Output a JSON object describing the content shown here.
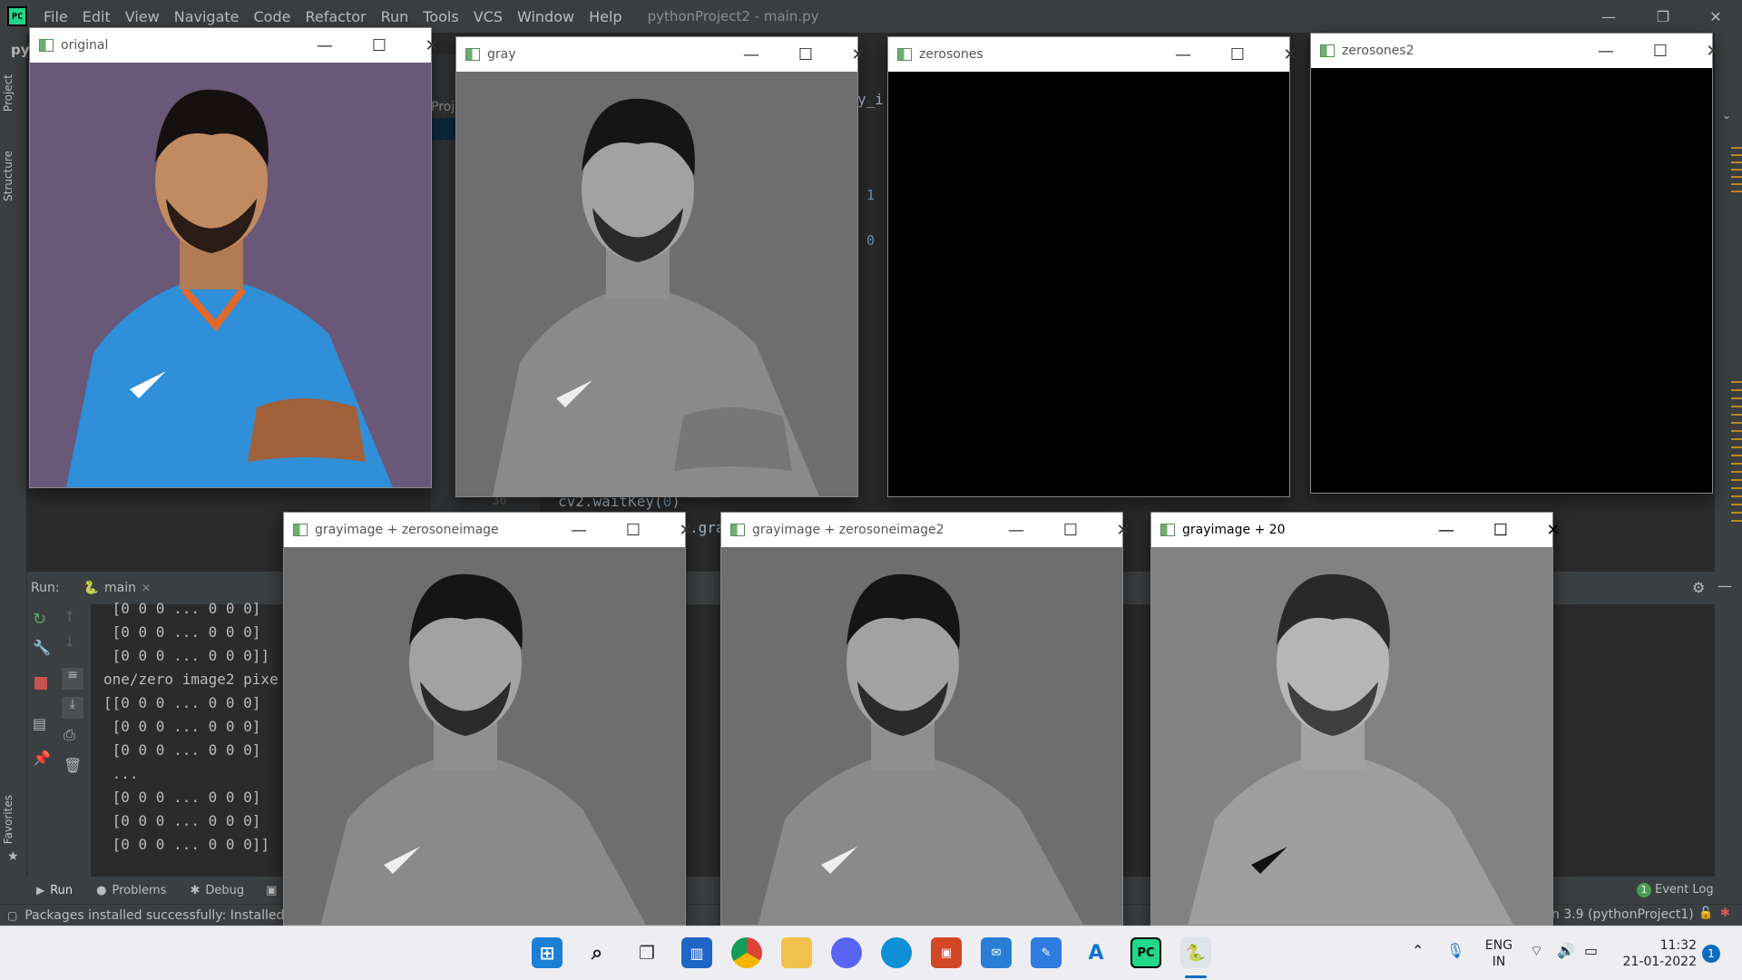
{
  "ide": {
    "logo": "PC",
    "menu": [
      "File",
      "Edit",
      "View",
      "Navigate",
      "Code",
      "Refactor",
      "Run",
      "Tools",
      "VCS",
      "Window",
      "Help"
    ],
    "title": "pythonProject2 - main.py",
    "side_tabs": {
      "project": "Project",
      "structure": "Structure",
      "favorites": "Favorites"
    },
    "project_prefix": "py",
    "project_fragment": "Proje",
    "editor_fragment": "y_i",
    "line_numbers_right": [
      "1",
      "0"
    ],
    "gutter_line": "36",
    "code_line_prefix": "cv2.waitKey(",
    "code_line_arg": "0",
    "code_line_suffix": ")",
    "code_fragment2": ".gra",
    "run_label": "Run:",
    "run_config": "main",
    "console": [
      " [0 0 0 ... 0 0 0]",
      " [0 0 0 ... 0 0 0]",
      " [0 0 0 ... 0 0 0]]",
      "one/zero image2 pixe",
      "[[0 0 0 ... 0 0 0]",
      " [0 0 0 ... 0 0 0]",
      " [0 0 0 ... 0 0 0]",
      " ...",
      " [0 0 0 ... 0 0 0]",
      " [0 0 0 ... 0 0 0]",
      " [0 0 0 ... 0 0 0]]"
    ],
    "bottom_tabs": {
      "run": "Run",
      "problems": "Problems",
      "debug": "Debug"
    },
    "event_log": "Event Log",
    "event_count": "1",
    "status_left": "Packages installed successfully: Installed pa",
    "status_right": "n 3.9 (pythonProject1)"
  },
  "windows": [
    {
      "title": "original",
      "content": "color-photo"
    },
    {
      "title": "gray",
      "content": "gray-photo"
    },
    {
      "title": "zerosones",
      "content": "black"
    },
    {
      "title": "zerosones2",
      "content": "black"
    },
    {
      "title": "grayimage + zerosoneimage",
      "content": "gray-photo"
    },
    {
      "title": "grayimage + zerosoneimage2",
      "content": "gray-photo"
    },
    {
      "title": "grayimage + 20",
      "content": "gray-photo",
      "active": true
    }
  ],
  "taskbar": {
    "apps": [
      "start-icon",
      "search-icon",
      "task-view-icon",
      "widgets-icon",
      "chrome-icon",
      "file-explorer-icon",
      "discord-icon",
      "edge-icon",
      "office-icon",
      "mail-icon",
      "notepad-icon",
      "azure-icon",
      "pycharm-icon",
      "python-icon"
    ],
    "lang_top": "ENG",
    "lang_bottom": "IN",
    "time": "11:32",
    "date": "21-01-2022",
    "notifications": "1"
  }
}
